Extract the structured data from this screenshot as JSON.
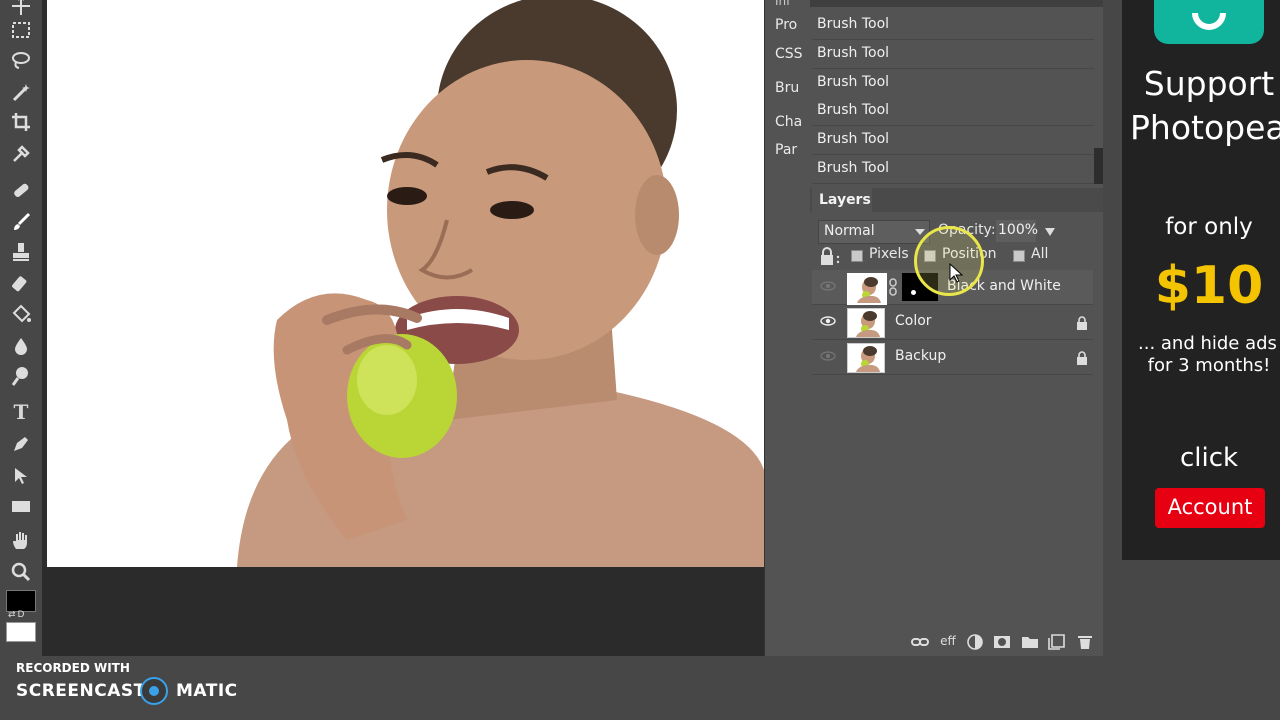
{
  "mini_panel": {
    "items": [
      "Pro",
      "CSS",
      "Bru",
      "Cha",
      "Par"
    ]
  },
  "history": {
    "items": [
      "Brush Tool",
      "Brush Tool",
      "Brush Tool",
      "Brush Tool",
      "Brush Tool",
      "Brush Tool"
    ]
  },
  "layers": {
    "tab_label": "Layers",
    "blend_mode": "Normal",
    "opacity_label": "Opacity:",
    "opacity_value": "100%",
    "lock_options": [
      "Pixels",
      "Position",
      "All"
    ],
    "rows": [
      {
        "name": "Black and White",
        "visible": false,
        "locked": false
      },
      {
        "name": "Color",
        "visible": true,
        "locked": true
      },
      {
        "name": "Backup",
        "visible": false,
        "locked": true
      }
    ],
    "toolbar_eff_label": "eff"
  },
  "toolbox": {
    "swap_label": "⇄D",
    "tools": [
      "move-icon",
      "marquee-icon",
      "lasso-icon",
      "magic-wand-icon",
      "crop-icon",
      "eyedropper-icon",
      "healing-icon",
      "brush-icon",
      "stamp-icon",
      "eraser-icon",
      "bucket-icon",
      "blur-icon",
      "dodge-icon",
      "text-icon",
      "pen-icon",
      "path-select-icon",
      "rectangle-icon",
      "hand-icon",
      "zoom-icon"
    ]
  },
  "ad": {
    "line1": "Support",
    "line2": "Photopea",
    "for_only": "for only",
    "price": "$10",
    "hide_line1": "... and hide ads",
    "hide_line2": "for 3 months!",
    "click": "click",
    "button": "Account"
  },
  "recorder": {
    "small": "RECORDED WITH",
    "brand_left": "SCREENCAST",
    "brand_right": "MATIC"
  },
  "colors": {
    "accent_teal": "#11b59d",
    "price_yellow": "#f5c400",
    "ad_button_red": "#e60012",
    "cursor_ring": "#e9e64a"
  }
}
